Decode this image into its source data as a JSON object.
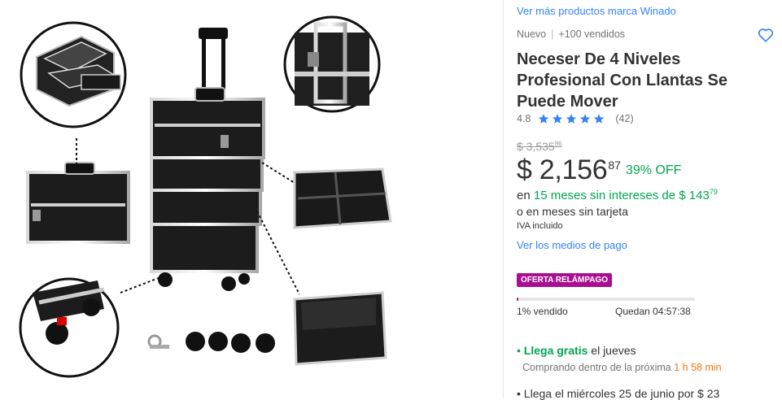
{
  "product": {
    "brand_link": "Ver más productos marca Winado",
    "condition": "Nuevo",
    "sold_count": "+100 vendidos",
    "title": "Neceser De 4 Niveles Profesional Con Llantas Se Puede Mover",
    "rating_value": "4.8",
    "rating_count": "(42)",
    "stars": 5
  },
  "pricing": {
    "old_price": "$ 3,535",
    "old_price_cents": "86",
    "price": "$ 2,156",
    "price_cents": "87",
    "discount": "39% OFF",
    "installments_prefix": "en",
    "installments_highlight": "15 meses sin intereses de $ 143",
    "installments_cents": "79",
    "installments_alt": "o en meses sin tarjeta",
    "tax_note": "IVA incluido",
    "payment_link": "Ver los medios de pago"
  },
  "deal": {
    "badge": "OFERTA RELÁMPAGO",
    "progress_percent": 1,
    "sold_label": "1% vendido",
    "remaining_label": "Quedan 04:57:38"
  },
  "shipping": {
    "line1_highlight": "Llega gratis",
    "line1_rest": "el jueves",
    "line1_sub_text": "Comprando dentro de la próxima",
    "line1_sub_time": "1 h 58 min",
    "line2": "Llega el miércoles 25 de junio por $ 23"
  },
  "colors": {
    "link": "#3483fa",
    "green": "#00a650",
    "deal": "#a90f90",
    "orange": "#f6760b"
  },
  "icons": {
    "favorite": "heart-outline-icon",
    "star": "star-icon",
    "bullet": "dot-icon"
  }
}
